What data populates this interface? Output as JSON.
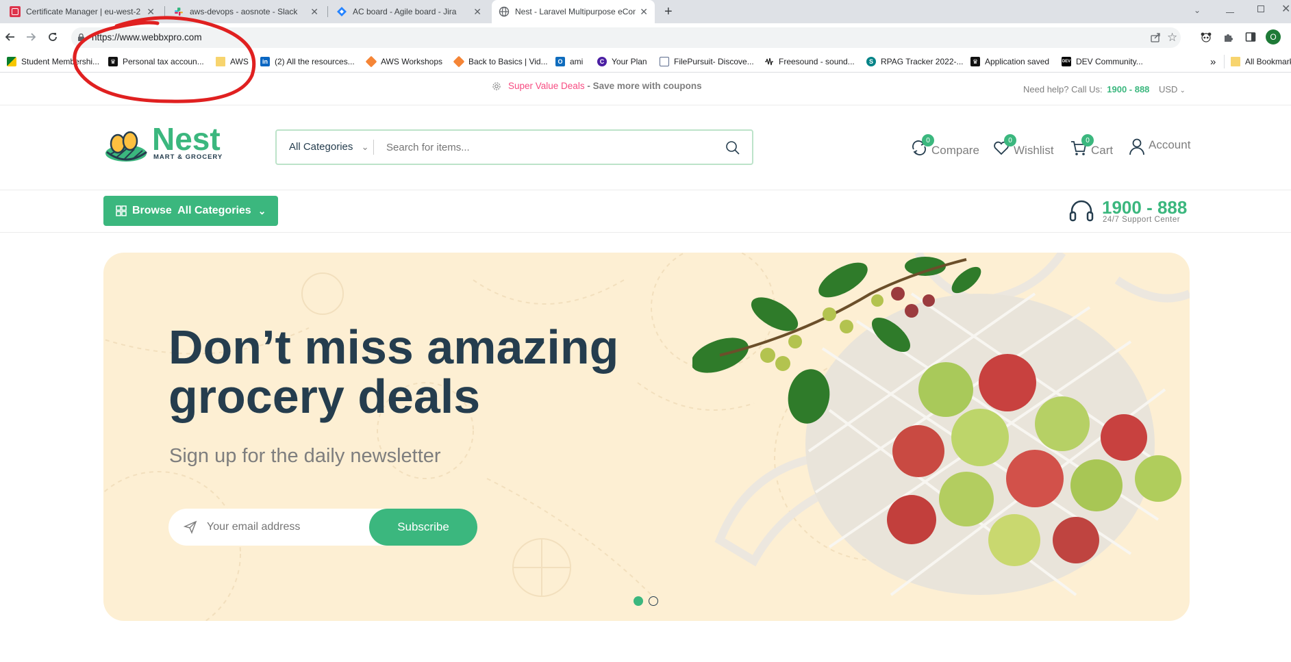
{
  "browser": {
    "tabs": [
      {
        "title": "Certificate Manager | eu-west-2",
        "favicon": "aws-certificate-icon",
        "active": false
      },
      {
        "title": "aws-devops - aosnote - Slack",
        "favicon": "slack-icon",
        "active": false
      },
      {
        "title": "AC board - Agile board - Jira",
        "favicon": "jira-icon",
        "active": false
      },
      {
        "title": "Nest - Laravel Multipurpose eCommerce",
        "favicon": "globe-icon",
        "active": true
      }
    ],
    "new_tab": "+",
    "url": "https://www.webbxpro.com",
    "profile_initial": "O",
    "bookmarks": [
      {
        "label": "Student Membershi...",
        "icon": "green-flag-icon"
      },
      {
        "label": "Personal tax accoun...",
        "icon": "crown-icon"
      },
      {
        "label": "AWS",
        "icon": "folder-icon"
      },
      {
        "label": "(2) All the resources...",
        "icon": "linkedin-icon"
      },
      {
        "label": "AWS Workshops",
        "icon": "aws-cube-icon"
      },
      {
        "label": "Back to Basics | Vid...",
        "icon": "aws-cube-icon"
      },
      {
        "label": "ami",
        "icon": "outlook-icon"
      },
      {
        "label": "Your Plan",
        "icon": "c-circle-icon"
      },
      {
        "label": "FilePursuit- Discove...",
        "icon": "filepursuit-icon"
      },
      {
        "label": "Freesound - sound...",
        "icon": "waveform-icon"
      },
      {
        "label": "RPAG Tracker 2022-...",
        "icon": "sharepoint-icon"
      },
      {
        "label": "Application saved",
        "icon": "crown-icon"
      },
      {
        "label": "DEV Community...",
        "icon": "dev-icon"
      }
    ],
    "more_bookmarks": "»",
    "all_bookmarks": "All Bookmarks"
  },
  "promo": {
    "deal": "Super Value Deals",
    "rest": " - Save more with coupons",
    "help_label": "Need help? Call Us:",
    "help_phone": "1900 - 888",
    "currency": "USD"
  },
  "header": {
    "logo_title": "Nest",
    "logo_sub": "MART & GROCERY",
    "category_select": "All Categories",
    "search_placeholder": "Search for items...",
    "compare": {
      "label": "Compare",
      "count": "0"
    },
    "wishlist": {
      "label": "Wishlist",
      "count": "0"
    },
    "cart": {
      "label": "Cart",
      "count": "0"
    },
    "account": "Account"
  },
  "nav": {
    "browse": "Browse  All Categories",
    "support_phone": "1900 - 888",
    "support_label": "24/7 Support Center"
  },
  "hero": {
    "headline_1": "Don’t miss amazing",
    "headline_2": "grocery deals",
    "subheadline": "Sign up for the daily newsletter",
    "email_placeholder": "Your email address",
    "subscribe": "Subscribe",
    "slides": 2,
    "active_slide": 1
  },
  "colors": {
    "brand": "#3bb77e",
    "heading": "#253d4e",
    "hero_bg": "#fdefd3",
    "deal": "#f74b81",
    "annotation": "#e02020"
  }
}
